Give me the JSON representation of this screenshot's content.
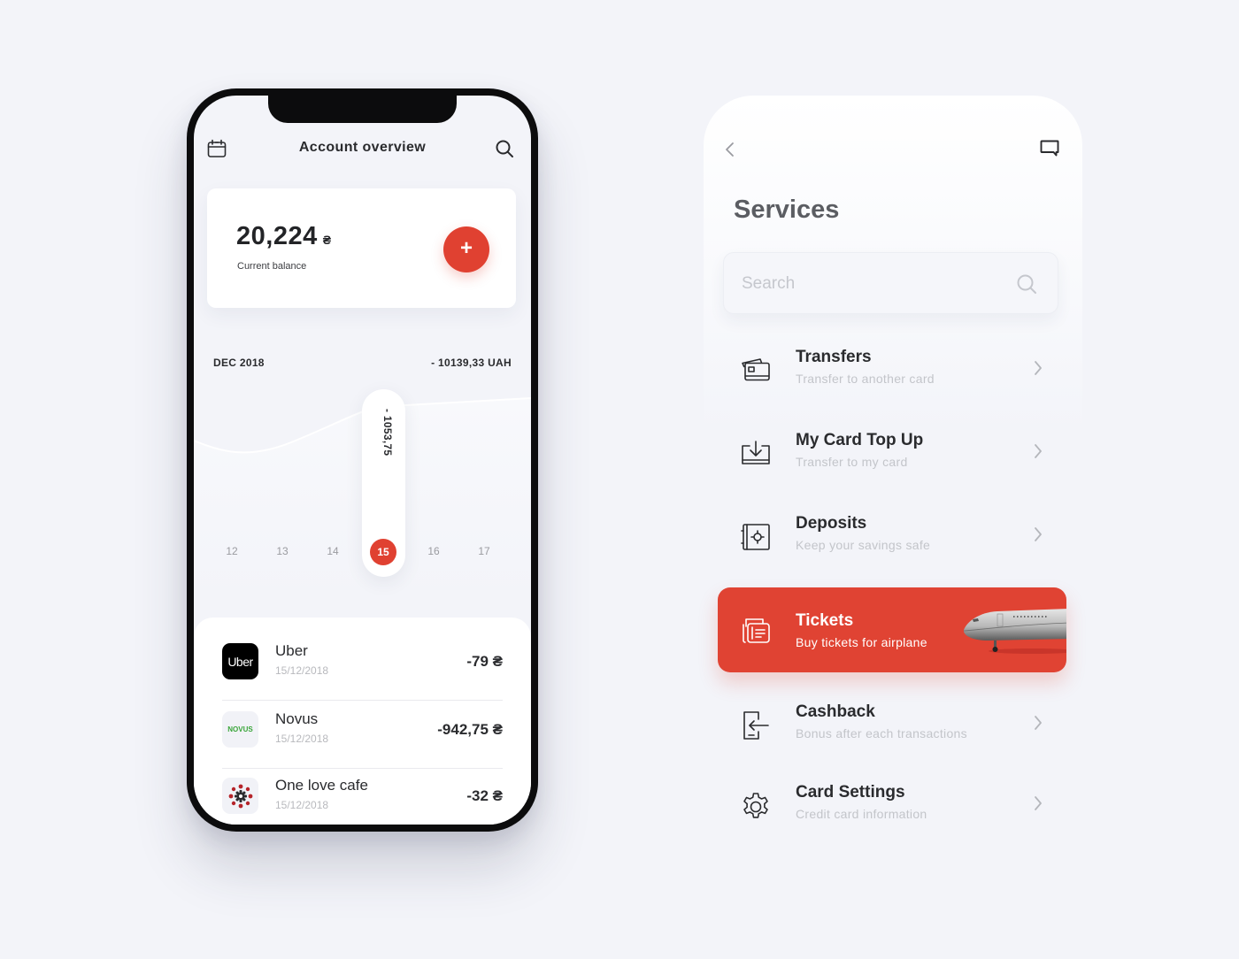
{
  "account": {
    "title": "Account overview",
    "icons": {
      "left": "calendar-icon",
      "right": "search-icon"
    },
    "balance": {
      "amount": "20,224",
      "currency": "₴",
      "label": "Current balance",
      "add_button": "+"
    },
    "period": {
      "label": "DEC 2018",
      "total": "- 10139,33 UAH"
    },
    "selected_day_value": "- 1053,75",
    "days": [
      {
        "label": "12",
        "active": false
      },
      {
        "label": "13",
        "active": false
      },
      {
        "label": "14",
        "active": false
      },
      {
        "label": "15",
        "active": true
      },
      {
        "label": "16",
        "active": false
      },
      {
        "label": "17",
        "active": false
      }
    ],
    "transactions": [
      {
        "name": "Uber",
        "date": "15/12/2018",
        "amount": "-79 ₴",
        "logo_text": "Uber"
      },
      {
        "name": "Novus",
        "date": "15/12/2018",
        "amount": "-942,75 ₴",
        "logo_text": "NOVUS"
      },
      {
        "name": "One love cafe",
        "date": "15/12/2018",
        "amount": "-32 ₴",
        "logo_text": ""
      }
    ]
  },
  "services": {
    "title": "Services",
    "search_placeholder": "Search",
    "search_value": "",
    "items": [
      {
        "label": "Transfers",
        "sub": "Transfer to another card",
        "icon": "cards-icon",
        "active": false
      },
      {
        "label": "My Card Top Up",
        "sub": "Transfer to my card",
        "icon": "download-card-icon",
        "active": false
      },
      {
        "label": "Deposits",
        "sub": "Keep your savings safe",
        "icon": "safe-icon",
        "active": false
      },
      {
        "label": "Tickets",
        "sub": "Buy tickets for airplane",
        "icon": "tickets-icon",
        "active": true
      },
      {
        "label": "Cashback",
        "sub": "Bonus after each transactions",
        "icon": "cashback-icon",
        "active": false
      },
      {
        "label": "Card Settings",
        "sub": "Credit card information",
        "icon": "gear-icon",
        "active": false
      }
    ]
  },
  "colors": {
    "accent": "#e04131",
    "background": "#f3f4f9",
    "text": "#2a2b2e",
    "muted": "#c3c5ca"
  }
}
